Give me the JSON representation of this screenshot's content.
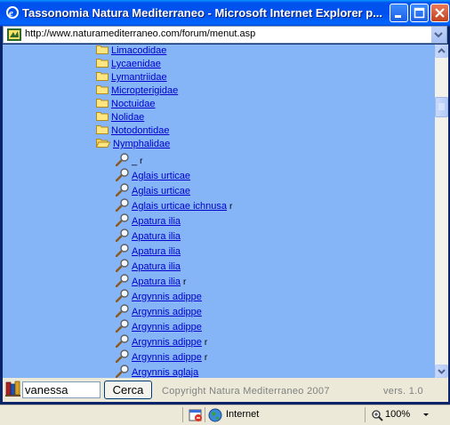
{
  "window": {
    "title": "Tassonomia Natura Mediterraneo - Microsoft Internet Explorer p..."
  },
  "address": {
    "url": "http://www.naturamediterraneo.com/forum/menut.asp"
  },
  "tree": {
    "folders": [
      {
        "label": "Limacodidae"
      },
      {
        "label": "Lycaenidae"
      },
      {
        "label": "Lymantriidae"
      },
      {
        "label": "Micropterigidae"
      },
      {
        "label": "Noctuidae"
      },
      {
        "label": "Nolidae"
      },
      {
        "label": "Notodontidae"
      },
      {
        "label": "Nymphalidae",
        "open": true
      }
    ],
    "species": [
      {
        "label": "_",
        "suffix": "r",
        "link": false
      },
      {
        "label": "Aglais urticae",
        "suffix": ""
      },
      {
        "label": "Aglais urticae",
        "suffix": ""
      },
      {
        "label": "Aglais urticae ichnusa",
        "suffix": "r"
      },
      {
        "label": "Apatura ilia",
        "suffix": ""
      },
      {
        "label": "Apatura ilia",
        "suffix": ""
      },
      {
        "label": "Apatura ilia",
        "suffix": ""
      },
      {
        "label": "Apatura ilia",
        "suffix": ""
      },
      {
        "label": "Apatura ilia",
        "suffix": "r"
      },
      {
        "label": "Argynnis adippe",
        "suffix": ""
      },
      {
        "label": "Argynnis adippe",
        "suffix": ""
      },
      {
        "label": "Argynnis adippe",
        "suffix": ""
      },
      {
        "label": "Argynnis adippe",
        "suffix": "r"
      },
      {
        "label": "Argynnis adippe",
        "suffix": "r"
      },
      {
        "label": "Argynnis aglaja",
        "suffix": ""
      }
    ]
  },
  "search": {
    "value": "vanessa",
    "button_label": "Cerca",
    "copyright": "Copyright Natura Mediterraneo 2007",
    "version": "vers. 1.0"
  },
  "status": {
    "zone": "Internet",
    "zoom": "100%"
  },
  "icons": {
    "app": "internet-explorer-icon",
    "folder": "folder-icon",
    "open_folder": "open-folder-icon",
    "species": "magnifier-icon",
    "search": "books-icon"
  },
  "colors": {
    "content_background": "#85b4f7",
    "link": "#0000cc",
    "titlebar": "#0053ee"
  }
}
